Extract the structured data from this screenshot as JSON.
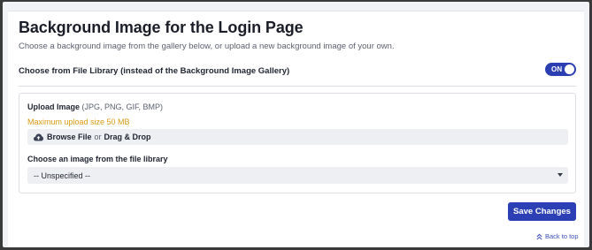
{
  "page": {
    "title": "Background Image for the Login Page",
    "description": "Choose a background image from the gallery below, or upload a new background image of your own."
  },
  "toggle": {
    "label": "Choose from File Library (instead of the Background Image Gallery)",
    "state_text": "ON",
    "checked": true
  },
  "upload": {
    "label": "Upload Image",
    "hint": "(JPG, PNG, GIF, BMP)",
    "max_size": "Maximum upload size 50 MB",
    "browse_text": "Browse File",
    "or_text": "or",
    "drag_text": "Drag & Drop",
    "icon": "cloud-upload-icon"
  },
  "library": {
    "label": "Choose an image from the file library",
    "selected": "-- Unspecified --"
  },
  "actions": {
    "save_label": "Save Changes",
    "back_to_top": "Back to top"
  },
  "colors": {
    "accent": "#2c3fb5",
    "warning": "#d99a12",
    "field_bg": "#eeeff2"
  }
}
